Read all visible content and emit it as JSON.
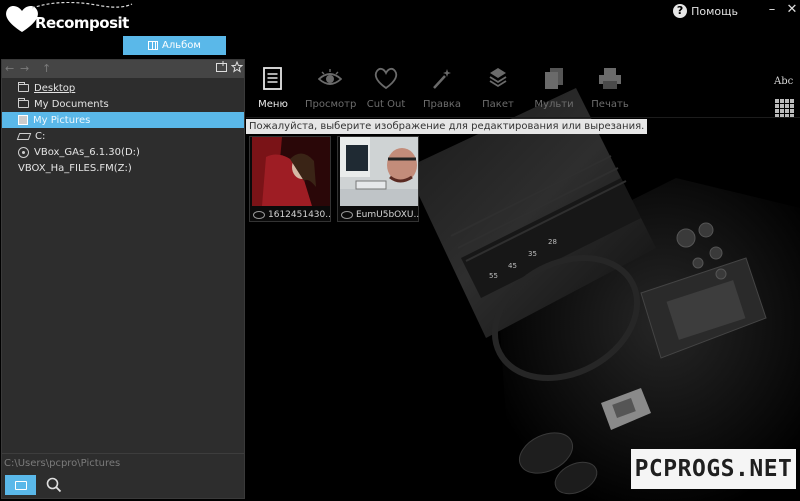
{
  "app": {
    "logo_text": "Recomposit"
  },
  "titlebar": {
    "help_label": "Помощь",
    "minimize_glyph": "–",
    "close_glyph": "✕"
  },
  "album_tab": {
    "label": "Альбом"
  },
  "nav": {
    "back_glyph": "←",
    "forward_glyph": "→",
    "up_glyph": "↑"
  },
  "tree": {
    "items": [
      {
        "label": "Desktop",
        "icon": "folder-icon"
      },
      {
        "label": "My Documents",
        "icon": "folder-icon"
      },
      {
        "label": "My Pictures",
        "icon": "pictures-icon",
        "selected": true
      },
      {
        "label": "C:",
        "icon": "drive-icon"
      },
      {
        "label": "VBox_GAs_6.1.30(D:)",
        "icon": "cd-icon"
      },
      {
        "label": "VBOX_Ha_FILES.FM(Z:)",
        "icon": "none"
      }
    ]
  },
  "status": {
    "path": "C:\\Users\\pcpro\\Pictures"
  },
  "toolbar": {
    "tools": [
      {
        "label": "Меню",
        "icon": "menu-icon",
        "active": true
      },
      {
        "label": "Просмотр",
        "icon": "eye-icon",
        "active": false
      },
      {
        "label": "Cut Out",
        "icon": "heart-cut-icon",
        "active": false
      },
      {
        "label": "Правка",
        "icon": "wand-icon",
        "active": false
      },
      {
        "label": "Пакет",
        "icon": "batch-icon",
        "active": false
      },
      {
        "label": "Мульти",
        "icon": "multi-icon",
        "active": false
      },
      {
        "label": "Печать",
        "icon": "printer-icon",
        "active": false
      }
    ],
    "abc_label": "Abc"
  },
  "hint": {
    "text": "Пожалуйста, выберите изображение для редактирования или вырезания."
  },
  "thumbnails": [
    {
      "label": "1612451430..."
    },
    {
      "label": "EumU5bOXU..."
    }
  ],
  "watermark": {
    "text": "PCPROGS.NET"
  },
  "colors": {
    "accent": "#5ab8e9",
    "panel": "#2d2d2d",
    "background": "#000000"
  }
}
